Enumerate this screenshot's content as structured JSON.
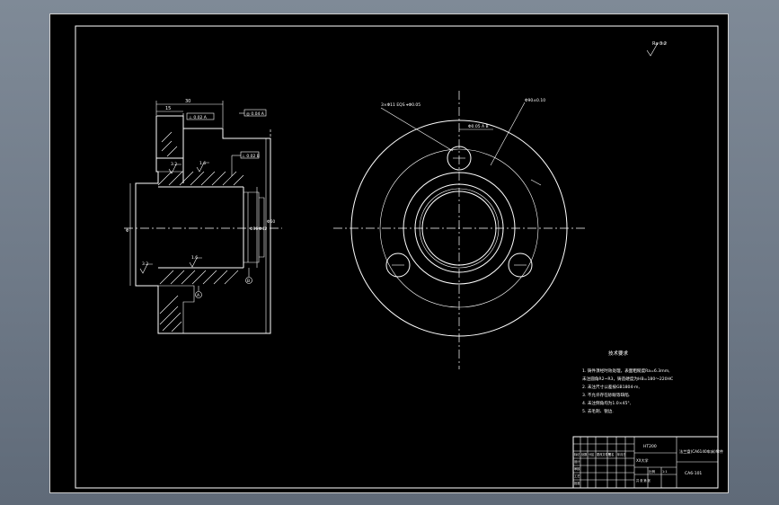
{
  "drawing": {
    "roughness_symbol": "Ra 3.2",
    "section_view": {
      "dim_top": "30",
      "dim_small": "15",
      "tolerance_frame_1": "⊥ 0.02 A",
      "tolerance_frame_2": "◎ 0.04 A",
      "tolerance_frame_3": "⊥ 0.02 B",
      "roughness_1": "1.6",
      "roughness_2": "3.2",
      "roughness_3": "1.6",
      "roughness_4": "3.2",
      "dim_left": "Φ",
      "dim_right_1": "Φ36",
      "dim_right_2": "Φ42",
      "dim_right_3": "Φ60",
      "datum_a": "A",
      "datum_b": "B"
    },
    "front_view": {
      "callout_left": "3×Φ11 EQS ⌖Φ0.05",
      "callout_right": "Φ90±0.10",
      "callout_top": "Φ0.05 A B"
    }
  },
  "tech_requirements": {
    "title": "技术要求",
    "lines": [
      "1. 铸件须经时效处理，表面粗糙度Ra=6.3mm,",
      "   未注圆角R2~R3，铸造硬度为HB=180～220HC",
      "2. 未注尺寸公差按GB1804-m,",
      "3. 不允许存在砂眼等缺陷.",
      "4. 未注倒角均为1.0×45°,",
      "5. 去毛刺、锐边."
    ]
  },
  "title_block": {
    "material": "HT200",
    "drawing_name": "法兰盘(CA6140车床)零件",
    "drawing_number": "CA6-101",
    "school": "XX大学",
    "labels": [
      "标记",
      "处数",
      "分区",
      "更改文件号",
      "签名",
      "年月日",
      "设计",
      "审核",
      "工艺",
      "批准"
    ],
    "scale_label": "比例",
    "scale": "1:1",
    "sheet": "共 张 第 张"
  }
}
